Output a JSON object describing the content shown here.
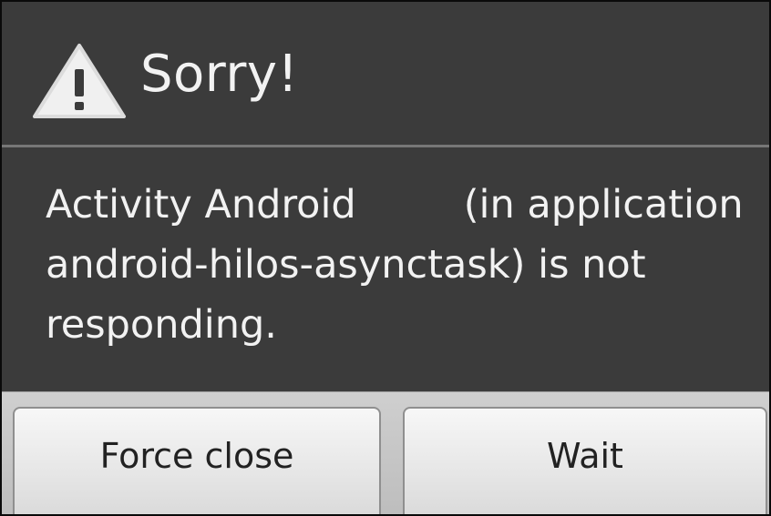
{
  "dialog": {
    "title": "Sorry!",
    "message_part1": "Activity Android",
    "message_part2": "(in application android-hilos-asynctask) is not responding.",
    "icon": "warning-icon"
  },
  "buttons": {
    "force_close_label": "Force close",
    "wait_label": "Wait"
  },
  "colors": {
    "dialog_background": "#3b3b3b",
    "text": "#f2f2f2",
    "button_face": "#e7e7e7",
    "warning_icon": "#f0f0f0"
  }
}
